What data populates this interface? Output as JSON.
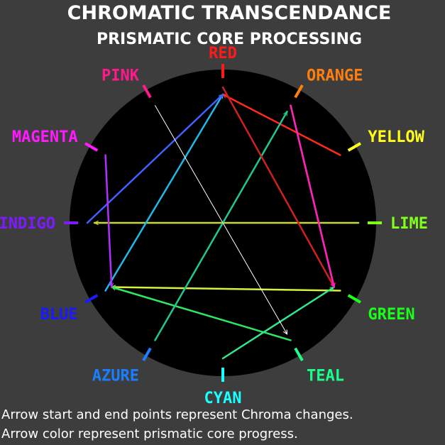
{
  "title": "CHROMATIC TRANSCENDANCE",
  "subtitle": "PRISMATIC CORE PROCESSING",
  "nodes": [
    {
      "label": "RED",
      "color": "#ff1a1a"
    },
    {
      "label": "ORANGE",
      "color": "#ff7f0e"
    },
    {
      "label": "YELLOW",
      "color": "#ffff1a"
    },
    {
      "label": "LIME",
      "color": "#7fff1a"
    },
    {
      "label": "GREEN",
      "color": "#1aff1a"
    },
    {
      "label": "TEAL",
      "color": "#1aff8c"
    },
    {
      "label": "CYAN",
      "color": "#1affff"
    },
    {
      "label": "AZURE",
      "color": "#1a7fff"
    },
    {
      "label": "BLUE",
      "color": "#1a1aff"
    },
    {
      "label": "INDIGO",
      "color": "#7f1aff"
    },
    {
      "label": "MAGENTA",
      "color": "#ff1aff"
    },
    {
      "label": "PINK",
      "color": "#ff1a8c"
    }
  ],
  "arrows": [
    {
      "from": "YELLOW",
      "to": "RED",
      "color": "#ff2a1a"
    },
    {
      "from": "ORANGE",
      "to": "GREEN",
      "color": "#ff5f2a"
    },
    {
      "from": "LIME",
      "to": "INDIGO",
      "color": "#c8d830"
    },
    {
      "from": "GREEN",
      "to": "BLUE",
      "color": "#d8f040"
    },
    {
      "from": "TEAL",
      "to": "BLUE",
      "color": "#30e860"
    },
    {
      "from": "CYAN",
      "to": "GREEN",
      "color": "#30e890"
    },
    {
      "from": "AZURE",
      "to": "ORANGE",
      "color": "#20c890"
    },
    {
      "from": "BLUE",
      "to": "RED",
      "color": "#20b8e8"
    },
    {
      "from": "INDIGO",
      "to": "RED",
      "color": "#4060ff"
    },
    {
      "from": "MAGENTA",
      "to": "BLUE",
      "color": "#b030ff"
    },
    {
      "from": "PINK",
      "to": "TEAL",
      "color": "#ffffff"
    },
    {
      "from": "RED",
      "to": "GREEN",
      "color": "#d02020"
    },
    {
      "from": "ORANGE",
      "to": "GREEN",
      "color": "#ff20c0"
    }
  ],
  "captions": [
    "Arrow start and end points represent Chroma changes.",
    "Arrow color represent prismatic core progress."
  ]
}
